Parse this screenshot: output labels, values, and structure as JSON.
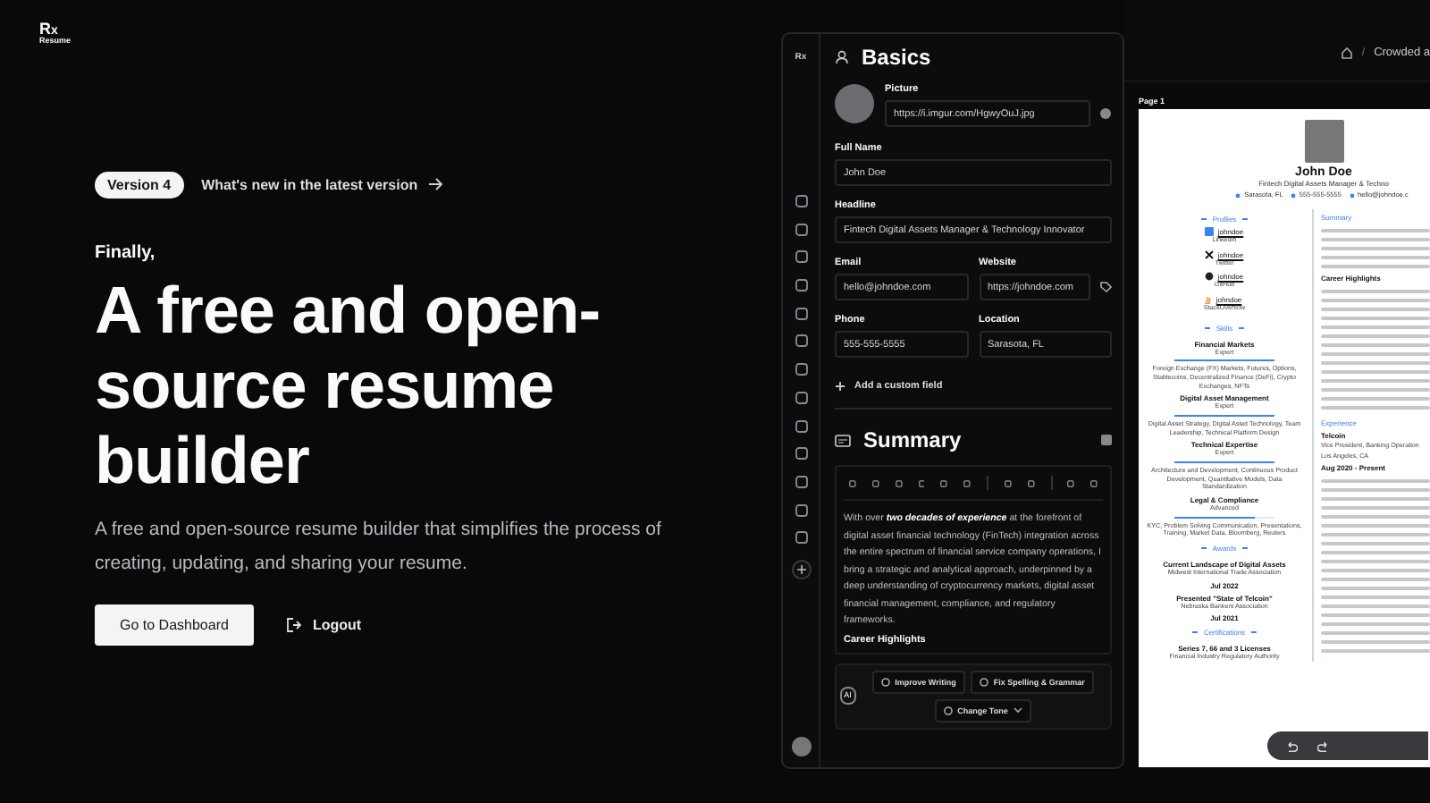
{
  "logo": {
    "mark": "R",
    "sub": "x",
    "word": "Resume"
  },
  "hero": {
    "badge": "Version 4",
    "link": "What's new in the latest version",
    "eyebrow": "Finally,",
    "title": "A free and open-source resume builder",
    "description": "A free and open-source resume builder that simplifies the process of creating, updating, and sharing your resume.",
    "primary_button": "Go to Dashboard",
    "secondary_button": "Logout"
  },
  "editor": {
    "sidebar_mark": "Rx",
    "basics": {
      "title": "Basics",
      "picture": {
        "label": "Picture",
        "value": "https://i.imgur.com/HgwyOuJ.jpg"
      },
      "fields": [
        {
          "label": "Full Name",
          "value": "John Doe",
          "kind": "wide"
        },
        {
          "label": "Headline",
          "value": "Fintech Digital Assets Manager & Technology Innovator",
          "kind": "wide"
        },
        {
          "label": "Email",
          "value": "hello@johndoe.com",
          "kind": "narrow"
        },
        {
          "label": "Website",
          "value": "https://johndoe.com",
          "kind": "narrow"
        },
        {
          "label": "Phone",
          "value": "555-555-5555",
          "kind": "narrow"
        },
        {
          "label": "Location",
          "value": "Sarasota, FL",
          "kind": "narrow"
        }
      ],
      "add_field": "Add a custom field"
    },
    "summary": {
      "title": "Summary",
      "text": "With over **two decades of experience** at the forefront of digital asset financial technology (FinTech) integration across the entire spectrum of financial service company operations, I bring a strategic and analytical approach, underpinned by a deep understanding of cryptocurrency markets, digital asset financial management, compliance, and regulatory frameworks.",
      "subheading": "Career Highlights",
      "ai_badge": "AI",
      "ai_actions": [
        "Improve Writing",
        "Fix Spelling & Grammar",
        "Change Tone"
      ]
    }
  },
  "preview": {
    "breadcrumb_separator": "/",
    "breadcrumb": "Crowded a",
    "page_label": "Page 1",
    "resume": {
      "name": "John Doe",
      "headline": "Fintech Digital Assets Manager & Techno",
      "contacts": [
        "Sarasota, FL",
        "555-555-5555",
        "hello@johndoe.c"
      ],
      "profiles_title": "Profiles",
      "profiles": [
        {
          "handle": "johndoe",
          "network": "LinkedIn",
          "kind": "square"
        },
        {
          "handle": "johndoe",
          "network": "Twitter",
          "kind": "x"
        },
        {
          "handle": "johndoe",
          "network": "GitHub",
          "kind": "circle"
        },
        {
          "handle": "johndoe",
          "network": "StackOverflow",
          "kind": "stack"
        }
      ],
      "skills_title": "Skills",
      "skills": [
        {
          "name": "Financial Markets",
          "level_text": "Expert",
          "level": 1,
          "keywords": "Foreign Exchange (FX) Markets, Futures, Options, Stablecoins, Decentralized Finance (DeFi), Crypto Exchanges, NFTs"
        },
        {
          "name": "Digital Asset Management",
          "level_text": "Expert",
          "level": 1,
          "keywords": "Digital Asset Strategy, Digital Asset Technology, Team Leadership, Technical Platform Design"
        },
        {
          "name": "Technical Expertise",
          "level_text": "Expert",
          "level": 1,
          "keywords": "Architecture and Development, Continuous Product Development, Quantitative Models, Data Standardization"
        },
        {
          "name": "Legal & Compliance",
          "level_text": "Advanced",
          "level": 0.8,
          "keywords": "KYC, Problem Solving Communication, Presentations, Training, Market Data, Bloomberg, Reuters"
        }
      ],
      "awards_title": "Awards",
      "awards": [
        {
          "title": "Current Landscape of Digital Assets",
          "awarder": "Midwest International Trade Association",
          "date": "Jul 2022"
        },
        {
          "title": "Presented \"State of Telcoin\"",
          "awarder": "Nebraska Bankers Association",
          "date": "Jul 2021"
        }
      ],
      "certifications_title": "Certifications",
      "certifications": [
        {
          "title": "Series 7, 66 and 3 Licenses",
          "issuer": "Financial Industry Regulatory Authority"
        }
      ],
      "summary_title": "Summary",
      "highlights_title": "Career Highlights",
      "experience_title": "Experience",
      "experience": [
        {
          "company": "Telcoin",
          "position": "Vice President, Banking Operation",
          "location": "Los Angeles, CA",
          "date": "Aug 2020 - Present"
        }
      ]
    }
  }
}
